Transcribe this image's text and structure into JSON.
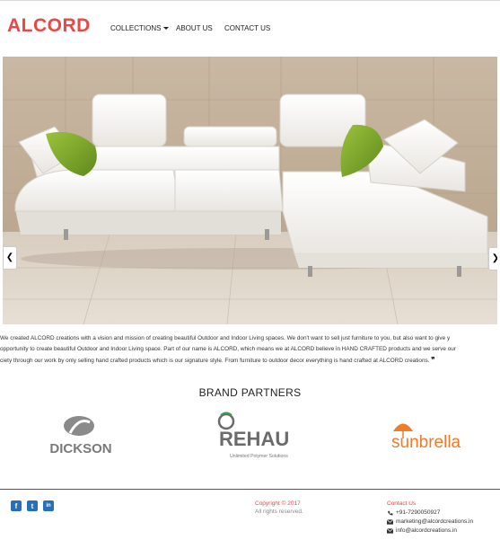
{
  "brand": {
    "logo_text": "ALCORD"
  },
  "nav": {
    "collections": "COLLECTIONS",
    "about": "ABOUT US",
    "contact": "CONTACT US"
  },
  "hero": {
    "prev_icon": "chevron-left-icon",
    "next_icon": "chevron-right-icon",
    "prev_glyph": "❮",
    "next_glyph": "❯"
  },
  "about": {
    "line1": "We created ALCORD creations with a vision and mission of creating beautiful Outdoor and Indoor Living spaces. We don't want to sell just furniture to you, but also want to give y",
    "line2": "opportunity to create beautiful Outdoor and Indoor Living space. Part of our name is ALCORD, which means we at ALCORD believe in HAND CRAFTED products and we serve our",
    "line3": "ciety through our work by only selling hand crafted products which is our signature style. From furniture to outdoor decor everything is hand crafted at ALCORD creations.",
    "quote_mark": "❞"
  },
  "partners": {
    "title": "BRAND PARTNERS",
    "dickson": {
      "name": "DICKSON"
    },
    "rehau": {
      "name": "REHAU",
      "tagline": "Unlimited Polymer Solutions"
    },
    "sunbrella": {
      "name": "sunbrella"
    }
  },
  "footer": {
    "social": [
      {
        "icon": "facebook-icon",
        "glyph": "f"
      },
      {
        "icon": "twitter-icon",
        "glyph": "t"
      },
      {
        "icon": "linkedin-icon",
        "glyph": "in"
      }
    ],
    "copyright": "Copyright © 2017",
    "rights": "All rights reserved.",
    "contact_title": "Contact Us",
    "phone": "+91-7290050927",
    "email1": "marketing@alcordcreations.in",
    "email2": "info@alcordcreations.in"
  },
  "colors": {
    "accent": "#e84848",
    "social": "#2a6eb5"
  }
}
